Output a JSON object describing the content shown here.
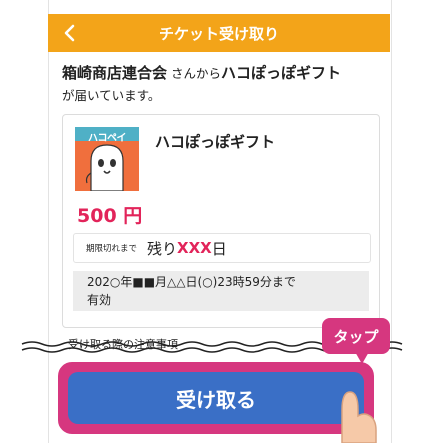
{
  "header": {
    "title": "チケット受け取り"
  },
  "message": {
    "sender": "箱崎商店連合会",
    "middle": " さんから",
    "gift": "ハコぽっぽギフト",
    "tail": "が届いています。"
  },
  "card": {
    "logo_text": "ハコペイ",
    "gift_name": "ハコぽっぽギフト",
    "amount": "500 円",
    "remain_label": "期限切れまで",
    "remain_prefix": "残り",
    "remain_value": "XXX",
    "remain_unit": "日",
    "expiry_line1": "202○年■■月△△日(○)23時59分まで",
    "expiry_line2": "有効"
  },
  "notice_label": "受け取る際の注意事項",
  "receive_button": "受け取る",
  "tap_label": "タップ",
  "colors": {
    "header": "#f3a419",
    "accent": "#e2245a",
    "button": "#3a6fc6",
    "highlight": "#d6377f"
  }
}
